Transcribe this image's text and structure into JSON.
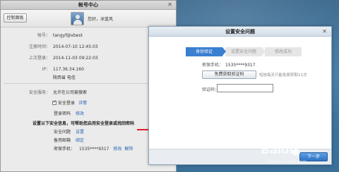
{
  "account_window": {
    "title": "帐号中心",
    "console_button": "控制面板",
    "greeting": "您好，冰蓝风",
    "fields": [
      {
        "label": "帐号：",
        "value": "tangyf@xbest"
      },
      {
        "label": "注册时间：",
        "value": "2014-07-10 12:45:03"
      },
      {
        "label": "上次登录：",
        "value": "2014-11-03 09:22:03"
      },
      {
        "label": "IP：",
        "value": "117.36.34.160"
      },
      {
        "label": "",
        "value": "陕西省 电信"
      }
    ],
    "security": {
      "service_label": "安全服务：",
      "service_value": "允许在公司被搜索",
      "secure_login_label": "安全登录",
      "secure_login_link": "详情",
      "login_password_label": "登录密码",
      "login_password_link": "修改",
      "warning": "设置以下安全信息，可帮助您启用安全登录或找回密码",
      "question_label": "安全问题",
      "question_link": "设置",
      "email_label": "备用邮箱",
      "email_link": "绑定",
      "phone_label": "密保手机：",
      "phone_value": "1535****9317",
      "phone_modify": "修改",
      "phone_unbind": "解除"
    }
  },
  "dialog": {
    "title": "设置安全问题",
    "steps": [
      "身份验证",
      "设置安全问题",
      "修改成功"
    ],
    "phone_label": "密保手机：",
    "phone_value": "1535****9317",
    "sms_button": "免费获取验证码",
    "sms_note": "短信每天只能免费获取11次",
    "code_label": "验证码：",
    "code_value": "",
    "next_button": "下一步"
  },
  "watermark": {
    "brand": "Baidu",
    "sub": "jingyan.baidu.com"
  },
  "colors": {
    "desktop": "#3f79a6",
    "arrow": "#e02020",
    "step_active": "#3a7fd0",
    "link": "#2a67b8"
  }
}
